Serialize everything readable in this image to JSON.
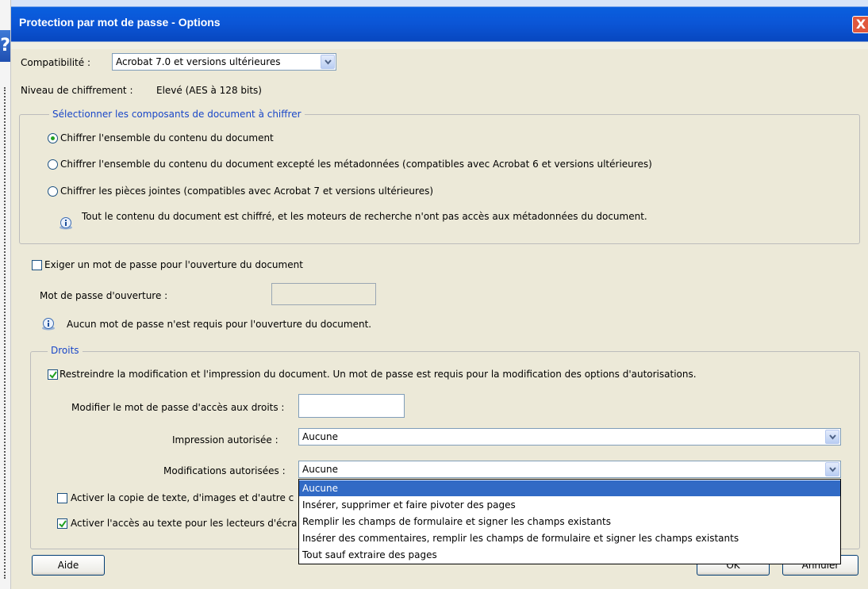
{
  "dialog": {
    "title": "Protection par mot de passe - Options",
    "close_symbol": "X",
    "background_question_glyph": "?"
  },
  "compatibility": {
    "label": "Compatibilité :",
    "value": "Acrobat 7.0 et versions ultérieures"
  },
  "encryption_level": {
    "label": "Niveau de chiffrement :",
    "value": "Elevé (AES à 128 bits)"
  },
  "components_group": {
    "legend": "Sélectionner les composants de document à chiffrer",
    "options": [
      {
        "label": "Chiffrer l'ensemble du contenu du document",
        "selected": true
      },
      {
        "label": "Chiffrer l'ensemble du contenu du document excepté les métadonnées (compatibles avec Acrobat 6 et versions ultérieures)",
        "selected": false
      },
      {
        "label": "Chiffrer les pièces jointes (compatibles avec Acrobat 7 et versions ultérieures)",
        "selected": false
      }
    ],
    "info": "Tout le contenu du document est chiffré, et les moteurs de recherche n'ont pas accès aux métadonnées du document."
  },
  "open_password": {
    "checkbox_label": "Exiger un mot de passe pour l'ouverture du document",
    "checked": false,
    "field_label": "Mot de passe d'ouverture :",
    "field_value": "",
    "info": "Aucun mot de passe n'est requis pour l'ouverture du document."
  },
  "rights_group": {
    "legend": "Droits",
    "restrict_label": "Restreindre la modification et l'impression du document. Un mot de passe est requis pour la modification des options d'autorisations.",
    "restrict_checked": true,
    "permissions_password_label": "Modifier le mot de passe d'accès aux droits :",
    "permissions_password_value": "",
    "printing_label": "Impression autorisée :",
    "printing_value": "Aucune",
    "changes_label": "Modifications autorisées :",
    "changes_value": "Aucune",
    "copy_label": "Activer la copie de texte, d'images et d'autre c",
    "copy_checked": false,
    "screen_reader_label": "Activer l'accès au texte pour les lecteurs d'écra",
    "screen_reader_checked": true
  },
  "changes_dropdown": {
    "options": [
      "Aucune",
      "Insérer, supprimer et faire pivoter des pages",
      "Remplir les champs de formulaire et signer les champs existants",
      "Insérer des commentaires, remplir les champs de formulaire et signer les champs existants",
      "Tout sauf extraire des pages"
    ],
    "highlighted_index": 0
  },
  "buttons": {
    "help": "Aide",
    "ok": "OK",
    "cancel": "Annuler"
  },
  "colors": {
    "title_bar": "#0b55d6",
    "legend_text": "#1a47c8",
    "selection": "#316ac5",
    "dialog_bg": "#ece9d8"
  }
}
